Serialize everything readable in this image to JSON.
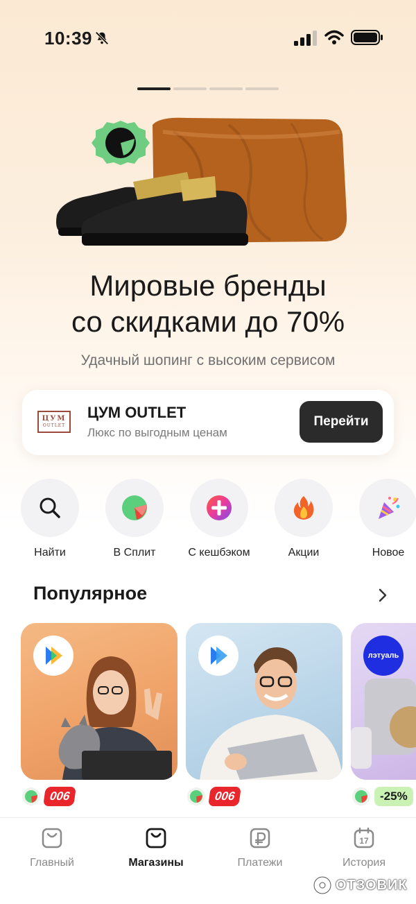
{
  "status_bar": {
    "time": "10:39",
    "icons": [
      "bell-slash-icon",
      "signal-icon",
      "wifi-icon",
      "battery-icon"
    ]
  },
  "carousel": {
    "pages": 4,
    "active_page": 1
  },
  "hero": {
    "title_line1": "Мировые бренды",
    "title_line2": "со скидками до 70%",
    "subtitle": "Удачный шопинг с высоким сервисом"
  },
  "promo": {
    "logo_line1": "ЦУМ",
    "logo_line2": "OUTLET",
    "title": "ЦУМ OUTLET",
    "subtitle": "Люкс по выгодным ценам",
    "button_label": "Перейти"
  },
  "quick_actions": [
    {
      "label": "Найти",
      "icon": "search-icon"
    },
    {
      "label": "В Сплит",
      "icon": "split-icon"
    },
    {
      "label": "С кешбэком",
      "icon": "cashback-plus-icon"
    },
    {
      "label": "Акции",
      "icon": "fire-icon"
    },
    {
      "label": "Новое",
      "icon": "party-popper-icon"
    }
  ],
  "popular": {
    "title": "Популярное",
    "cards": [
      {
        "brand_icon": "play-logo-icon",
        "tag": "006",
        "tag_style": "red"
      },
      {
        "brand_icon": "play-logo-icon",
        "tag": "006",
        "tag_style": "red"
      },
      {
        "brand_text": "лэтуаль",
        "tag": "-25%",
        "tag_style": "green"
      }
    ]
  },
  "tabbar": {
    "tabs": [
      {
        "label": "Главный",
        "icon": "bag-icon",
        "active": false
      },
      {
        "label": "Магазины",
        "icon": "shop-bag-icon",
        "active": true
      },
      {
        "label": "Платежи",
        "icon": "ruble-icon",
        "active": false
      },
      {
        "label": "История",
        "icon": "calendar-icon",
        "active": false
      }
    ],
    "calendar_day": "17"
  },
  "watermark": {
    "text": "ОТЗОВИК"
  },
  "colors": {
    "accent_dark": "#2b2b2b",
    "discount_red": "#e8262b",
    "discount_green": "#c9f2b4",
    "split_green": "#5ccf7c"
  }
}
